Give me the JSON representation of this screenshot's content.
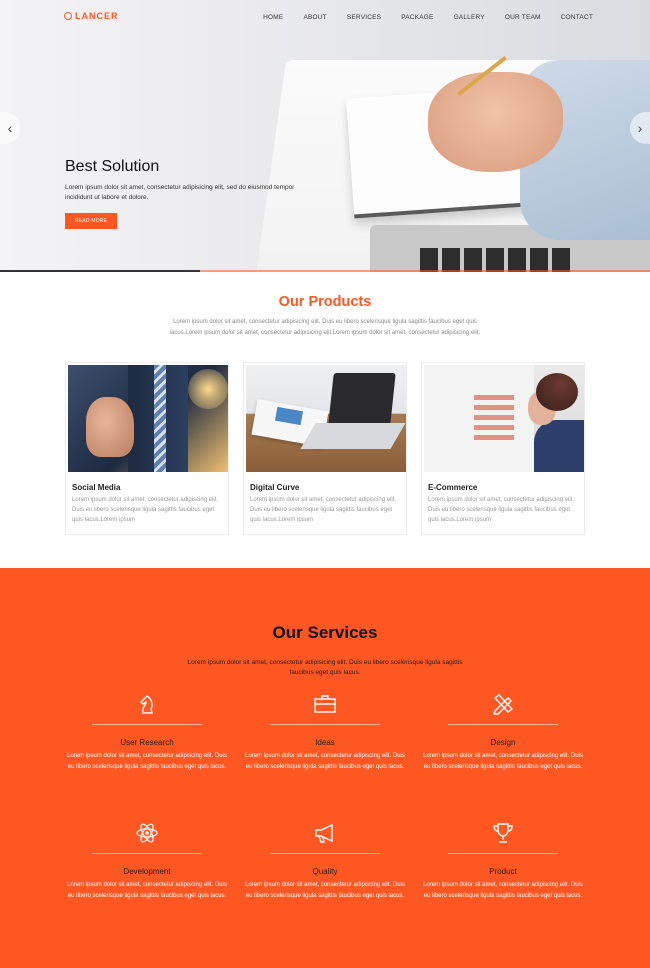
{
  "brand": {
    "name": "LANCER",
    "accent": "#ff5722"
  },
  "nav": {
    "items": [
      "HOME",
      "ABOUT",
      "SERVICES",
      "PACKAGE",
      "GALLERY",
      "OUR TEAM",
      "CONTACT"
    ]
  },
  "hero": {
    "title": "Best Solution",
    "text": "Lorem ipsum dolor sit amet, consectetur adipisicing elit, sed do eiusmod tempor incididunt ut labore et dolore.",
    "button": "READ MORE",
    "prev_arrow": "‹",
    "next_arrow": "›"
  },
  "products": {
    "title": "Our Products",
    "text": "Lorem ipsum dolor sit amet, consectetur adipisicing elit. Duis eu libero scelerisque ligula sagittis faucibus eget quis lacus.Lorem ipsum dolor sit amet, consectetur adipisicing elit.Lorem ipsum dolor sit amet, consectetur adipisicing elit.",
    "items": [
      {
        "title": "Social Media",
        "text": "Lorem ipsum dolor sit amet, consectetur adipiscing elit. Duis eu libero scelerisque ligula sagittis faucibus eget quis lacus.Lorem ipsum"
      },
      {
        "title": "Digital Curve",
        "text": "Lorem ipsum dolor sit amet, consectetur adipiscing elit. Duis eu libero scelerisque ligula sagittis faucibus eget quis lacus.Lorem ipsum"
      },
      {
        "title": "E-Commerce",
        "text": "Lorem ipsum dolor sit amet, consectetur adipiscing elit. Duis eu libero scelerisque ligula sagittis faucibus eget quis lacus.Lorem ipsum"
      }
    ]
  },
  "services": {
    "title": "Our Services",
    "text": "Lorem ipsum dolor sit amet, consectetur adipisicing elit. Duis eu libero scelerisque ligula sagittis faucibus eget quis lacus.",
    "items": [
      {
        "icon": "chess-knight-icon",
        "title": "User Research",
        "text": "Lorem ipsum dolor sit amet, consectetur adipiscing elit. Duis eu libero scelerisque ligula sagittis faucibus eget quis lacus."
      },
      {
        "icon": "briefcase-icon",
        "title": "Ideas",
        "text": "Lorem ipsum dolor sit amet, consectetur adipiscing elit. Duis eu libero scelerisque ligula sagittis faucibus eget quis lacus."
      },
      {
        "icon": "pencil-ruler-icon",
        "title": "Design",
        "text": "Lorem ipsum dolor sit amet, consectetur adipiscing elit. Duis eu libero scelerisque ligula sagittis faucibus eget quis lacus."
      },
      {
        "icon": "atom-icon",
        "title": "Development",
        "text": "Lorem ipsum dolor sit amet, consectetur adipiscing elit. Duis eu libero scelerisque ligula sagittis faucibus eget quis lacus."
      },
      {
        "icon": "megaphone-icon",
        "title": "Quality",
        "text": "Lorem ipsum dolor sit amet, consectetur adipiscing elit. Duis eu libero scelerisque ligula sagittis faucibus eget quis lacus."
      },
      {
        "icon": "trophy-icon",
        "title": "Product",
        "text": "Lorem ipsum dolor sit amet, consectetur adipiscing elit. Duis eu libero scelerisque ligula sagittis faucibus eget quis lacus."
      }
    ]
  }
}
